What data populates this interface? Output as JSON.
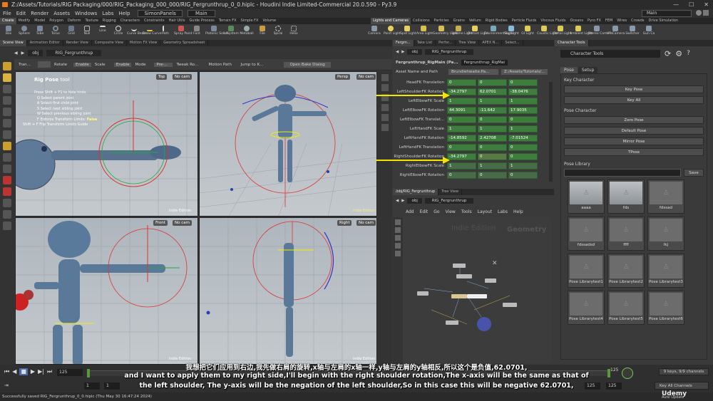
{
  "window": {
    "title": "Z:/Assets/Tutorials/RIG Packaging/000/RIG_Packaging_000_000/RIG_Fergrunthrup_0_0.hiplc - Houdini Indie Limited-Commercial 20.0.590 - Py3.9"
  },
  "menubar": {
    "items": [
      "File",
      "Edit",
      "Render",
      "Assets",
      "Windows",
      "Labs",
      "Help"
    ],
    "desk": "SimonPanels",
    "desk_main": "Main",
    "main_right": "Main"
  },
  "shelf_tabs": [
    "Create",
    "Modify",
    "Model",
    "Polygon",
    "Deform",
    "Texture",
    "Rigging",
    "Characters",
    "Constraints",
    "Hair Utils",
    "Guide Process",
    "Terrain FX",
    "Simple FX",
    "Volume",
    "Lights and Cameras",
    "Collisions",
    "Particles",
    "Grains",
    "Vellum",
    "Rigid Bodies",
    "Particle Fluids",
    "Viscous Fluids",
    "Oceans",
    "Pyro FX",
    "FEM",
    "Wires",
    "Crowds",
    "Drive Simulation"
  ],
  "shelf_tools_left": [
    "Box",
    "Sphere",
    "Tube",
    "Torus",
    "Grid",
    "Null",
    "Line",
    "Circle",
    "Curve Bezier",
    "Draw Curve",
    "Path",
    "Spray Paint",
    "Font",
    "Platonic Solids",
    "L-System",
    "Metaball",
    "File",
    "Spiral",
    "Helix"
  ],
  "shelf_tools_right": [
    "Camera",
    "Point Light",
    "Spot Light",
    "Area Light",
    "Geometry Light",
    "Volume Light",
    "Distant Light",
    "Environment Light",
    "Sky Light",
    "GI Light",
    "Caustic Light",
    "Portal Light",
    "Ambient Light",
    "Stereo Camera",
    "VR Camera",
    "Switcher",
    "Gun Ca"
  ],
  "left_pane": {
    "tabs": [
      "Scene View",
      "Animation Editor",
      "Render View",
      "Composite View",
      "Motion FX View",
      "Geometry Spreadsheet"
    ],
    "path": "obj",
    "object": "RIG_Fergrunthrup"
  },
  "viewport_toolbar": {
    "translate": "Tran...",
    "rotate": "Rotate",
    "enable1": "Enable",
    "scale": "Scale",
    "enable2": "Enable",
    "mode": "Mode",
    "pre": "Pre-...",
    "tweak": "Tweak Ro...",
    "motion_path": "Motion Path",
    "jump": "Jump to K...",
    "bake": "Open Bake Dialog"
  },
  "hud": {
    "title": "Rig Pose",
    "title_suffix": "tool",
    "lines": [
      "Press Shift + F1 to hide hints",
      "Q  Select parent joint",
      "A  Select first child joint",
      "S  Select next sibling joint",
      "W  Select previous sibling joint",
      "F  Enforce Transform Limits:",
      "Shift + F  Flip Transform Limits Guide"
    ],
    "limits_value": "False"
  },
  "viewports": {
    "top": "Top",
    "persp": "Persp",
    "front": "Front",
    "right": "Right",
    "nocam": "No cam",
    "indie": "Indie Edition"
  },
  "param_pane": {
    "tabs": [
      "Fergrn...",
      "Take List",
      "Perfor...",
      "Tree View",
      "APEX N...",
      "Select..."
    ],
    "path": "obj",
    "object": "RIG_Fergrunthrup",
    "node_label": "Fergrunthrup_RigMain (Pa...",
    "node_field": "Fergrunthrup_RigMai",
    "asset_name_label": "Asset Name and Path",
    "asset_name": "Brundlehwaite:Pa...",
    "asset_path": "Z:/Assets/Tutorials/...",
    "rows": [
      {
        "name": "HeadFK Translation",
        "v": [
          "0",
          "0",
          "0"
        ]
      },
      {
        "name": "LeftShoulderFK Rotation",
        "v": [
          "-34.2797",
          "62.0701",
          "-38.0476"
        ]
      },
      {
        "name": "LeftElbowFK Scale",
        "v": [
          "1",
          "1",
          "1"
        ]
      },
      {
        "name": "LeftElbowFK Rotation",
        "v": [
          "44.3091",
          "-11.642",
          "17.9035"
        ]
      },
      {
        "name": "LeftElbowFK Translat...",
        "v": [
          "0",
          "0",
          "0"
        ]
      },
      {
        "name": "LeftHandFK Scale",
        "v": [
          "1",
          "1",
          "1"
        ]
      },
      {
        "name": "LeftHandFK Rotation",
        "v": [
          "-14.8592",
          "2.42708",
          "-7.01524"
        ]
      },
      {
        "name": "LeftHandFK Translation",
        "v": [
          "0",
          "0",
          "0"
        ]
      },
      {
        "name": "RightShoulderFK Rotation",
        "v": [
          "-34.2797",
          "0",
          "0"
        ]
      },
      {
        "name": "RightElbowFK Scale",
        "v": [
          "1",
          "1",
          "1"
        ]
      },
      {
        "name": "RightElbowFK Rotation",
        "v": [
          "0",
          "0",
          "0"
        ]
      }
    ]
  },
  "network_pane": {
    "tabs": [
      "/obj/RIG_Fergrunthrup",
      "Tree View"
    ],
    "path": "obj",
    "object": "RIG_Fergrunthrup",
    "menu": [
      "Add",
      "Edit",
      "Go",
      "View",
      "Tools",
      "Layout",
      "Labs",
      "Help"
    ],
    "watermark1": "Indie Edition",
    "watermark2": "Geometry"
  },
  "right_panel": {
    "tabs": [
      "Character Tools"
    ],
    "title": "Character Tools",
    "subtabs": [
      "Pose",
      "Setup"
    ],
    "key_character_label": "Key Character",
    "key_pose": "Key Pose",
    "key_all": "Key All",
    "pose_character_label": "Pose Character",
    "zero_pose": "Zero Pose",
    "default_pose": "Default Pose",
    "mirror_pose": "Mirror Pose",
    "tpose": "TPose",
    "pose_library_label": "Pose Library",
    "save": "Save",
    "library": [
      "aaaa",
      "fds",
      "fdssad",
      "fdssadsd",
      "ffff",
      "lkj",
      "Pose Librarytest1",
      "Pose Librarytest2",
      "Pose Librarytest3",
      "Pose Librarytest4",
      "Pose Librarytest5",
      "Pose Librarytest6"
    ]
  },
  "timeline": {
    "frame": "125",
    "start": "1",
    "start2": "1",
    "end": "125",
    "end2": "125",
    "keys": "9 keys, 9/9 channels",
    "key_all": "Key All Channels",
    "auto": "Auto Update"
  },
  "subtitles": {
    "zh": "我想把它们应用到右边,我先做右肩的旋转,x轴与左肩的x轴一样,y轴与左肩的y轴相反,所以这个是负值,62.0701,",
    "en1": "and I want to apply them to my right side,I'll begin with the right shoulder rotation,The x-axis will be the same as that of",
    "en2": "the left shoulder, The y-axis will be the negation of the left shoulder,So in this case this will be negative 62.0701,"
  },
  "status": "Successfully saved RIG_Fergrunthrup_0_0.hiplc (Thu May 30 16:47:24 2024)",
  "watermark": "Udemy",
  "colors": {
    "accent_yellow": "#f5e400",
    "param_green": "#3f7d3e"
  }
}
